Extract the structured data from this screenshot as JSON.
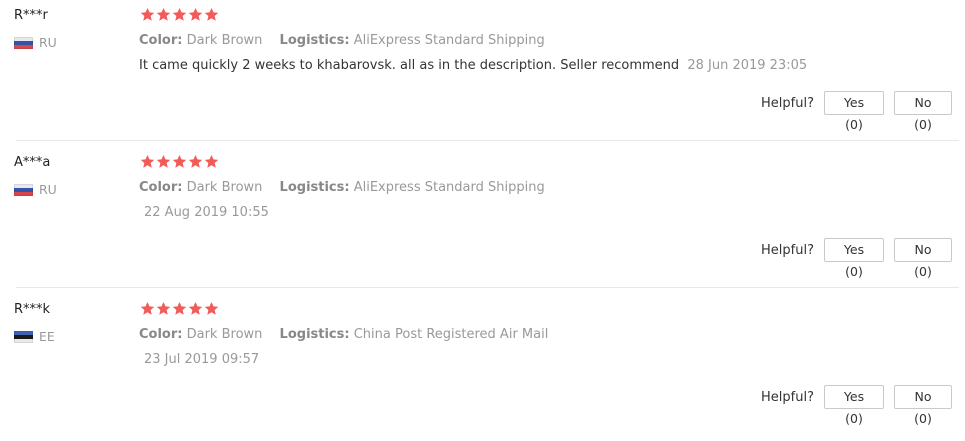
{
  "labels": {
    "color": "Color:",
    "logistics": "Logistics:",
    "helpful": "Helpful?"
  },
  "accent_colors": {
    "star": "#f25b57",
    "muted_text": "#999999"
  },
  "reviews": [
    {
      "user": "R***r",
      "country": "RU",
      "flag_icon": "russia-flag-icon",
      "rating": 5,
      "color_value": "Dark Brown",
      "logistics_value": "AliExpress Standard Shipping",
      "text": "It came quickly 2 weeks to khabarovsk. all as in the description. Seller recommend",
      "date": "28 Jun 2019 23:05",
      "yes_label": "Yes (0)",
      "no_label": "No (0)"
    },
    {
      "user": "A***a",
      "country": "RU",
      "flag_icon": "russia-flag-icon",
      "rating": 5,
      "color_value": "Dark Brown",
      "logistics_value": "AliExpress Standard Shipping",
      "text": "",
      "date": "22 Aug 2019 10:55",
      "yes_label": "Yes (0)",
      "no_label": "No (0)"
    },
    {
      "user": "R***k",
      "country": "EE",
      "flag_icon": "estonia-flag-icon",
      "rating": 5,
      "color_value": "Dark Brown",
      "logistics_value": "China Post Registered Air Mail",
      "text": "",
      "date": "23 Jul 2019 09:57",
      "yes_label": "Yes (0)",
      "no_label": "No (0)"
    }
  ]
}
